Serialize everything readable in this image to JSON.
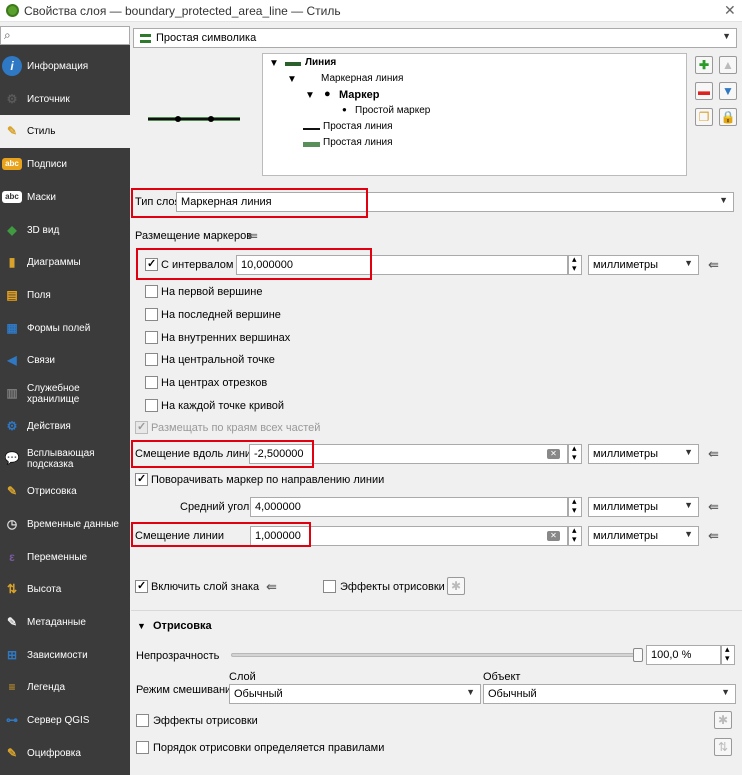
{
  "window": {
    "title": "Свойства слоя — boundary_protected_area_line — Стиль",
    "close": "✕"
  },
  "sidebar": {
    "search_placeholder": "",
    "items": [
      {
        "label": "Информация",
        "glyph": "i",
        "color": "#2f78c4",
        "icon": "info-icon"
      },
      {
        "label": "Источник",
        "glyph": "⚙",
        "color": "#5a5a5a",
        "icon": "source-wrench-icon"
      },
      {
        "label": "Стиль",
        "glyph": "✎",
        "color": "#d9a22a",
        "icon": "style-brush-icon"
      },
      {
        "label": "Подписи",
        "glyph": "abc",
        "color": "#e8a21b",
        "icon": "labels-abc-icon"
      },
      {
        "label": "Маски",
        "glyph": "abc",
        "color": "#ffffff",
        "icon": "masks-abc-icon"
      },
      {
        "label": "3D вид",
        "glyph": "◆",
        "color": "#3f9b3f",
        "icon": "3d-cube-icon"
      },
      {
        "label": "Диаграммы",
        "glyph": "▮",
        "color": "#d9a22a",
        "icon": "diagrams-bar-icon"
      },
      {
        "label": "Поля",
        "glyph": "▤",
        "color": "#e8a21b",
        "icon": "fields-table-icon"
      },
      {
        "label": "Формы полей",
        "glyph": "▦",
        "color": "#2f78c4",
        "icon": "forms-icon"
      },
      {
        "label": "Связи",
        "glyph": "◀",
        "color": "#2f78c4",
        "icon": "joins-icon"
      },
      {
        "label": "Служебное хранилище",
        "glyph": "▥",
        "color": "#7a7a7a",
        "icon": "storage-icon"
      },
      {
        "label": "Действия",
        "glyph": "⚙",
        "color": "#2f78c4",
        "icon": "actions-gear-icon"
      },
      {
        "label": "Всплывающая подсказка",
        "glyph": "💬",
        "color": "#e8c21b",
        "icon": "tooltip-bubble-icon"
      },
      {
        "label": "Отрисовка",
        "glyph": "✎",
        "color": "#d9a22a",
        "icon": "rendering-brush-icon"
      },
      {
        "label": "Временные данные",
        "glyph": "◷",
        "color": "#dddddd",
        "icon": "temporal-clock-icon"
      },
      {
        "label": "Переменные",
        "glyph": "ε",
        "color": "#7a5aa0",
        "icon": "variables-icon"
      },
      {
        "label": "Высота",
        "glyph": "⇅",
        "color": "#d9a22a",
        "icon": "elevation-icon"
      },
      {
        "label": "Метаданные",
        "glyph": "✎",
        "color": "#eeeeee",
        "icon": "metadata-icon"
      },
      {
        "label": "Зависимости",
        "glyph": "⊞",
        "color": "#2f78c4",
        "icon": "dependencies-icon"
      },
      {
        "label": "Легенда",
        "glyph": "≡",
        "color": "#d9a22a",
        "icon": "legend-icon"
      },
      {
        "label": "Сервер QGIS",
        "glyph": "⊶",
        "color": "#2f78c4",
        "icon": "qgis-server-icon"
      },
      {
        "label": "Оцифровка",
        "glyph": "✎",
        "color": "#d9a22a",
        "icon": "digitizing-icon"
      }
    ]
  },
  "renderer": {
    "label": "Простая символика"
  },
  "tree": {
    "root": "Линия",
    "marker_line": "Маркерная линия",
    "marker": "Маркер",
    "simple_marker": "Простой маркер",
    "simple_line_1": "Простая линия",
    "simple_line_2": "Простая линия"
  },
  "layer_type": {
    "label": "Тип слоя",
    "value": "Маркерная линия"
  },
  "placement": {
    "header": "Размещение маркеров",
    "interval_label": "С интервалом",
    "interval_value": "10,000000",
    "interval_unit": "миллиметры",
    "options": [
      "На первой вершине",
      "На последней вершине",
      "На внутренних вершинах",
      "На центральной точке",
      "На центрах отрезков",
      "На каждой точке кривой"
    ],
    "place_on_parts": "Размещать по краям всех частей"
  },
  "offset_along": {
    "label": "Смещение вдоль линии",
    "value": "-2,500000",
    "unit": "миллиметры"
  },
  "rotate": {
    "label": "Поворачивать маркер по направлению линии"
  },
  "avg_angle": {
    "label": "Средний угол",
    "value": "4,000000",
    "unit": "миллиметры"
  },
  "line_offset": {
    "label": "Смещение линии",
    "value": "1,000000",
    "unit": "миллиметры"
  },
  "enable_layer": {
    "label": "Включить слой знака"
  },
  "draw_effects_top": {
    "label": "Эффекты отрисовки"
  },
  "rendering": {
    "header": "Отрисовка",
    "opacity_label": "Непрозрачность",
    "opacity_value": "100,0 %",
    "opacity": 1.0,
    "blend_label": "Режим смешивания",
    "layer_col": "Слой",
    "object_col": "Объект",
    "layer_blend": "Обычный",
    "object_blend": "Обычный",
    "effects": "Эффекты отрисовки",
    "order": "Порядок отрисовки определяется правилами"
  }
}
